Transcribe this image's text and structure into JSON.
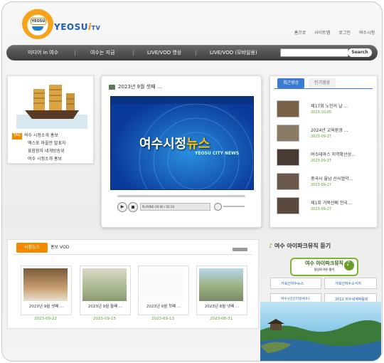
{
  "header": {
    "logo_badge": "YEOSU",
    "brand_name": "YEOSU",
    "brand_i": "i",
    "brand_tv": "TV",
    "top_links": [
      "홈으로",
      "사이트맵",
      "로그인",
      "여수시청"
    ]
  },
  "nav": {
    "items": [
      "미디어 in 여수",
      "여수는 지금",
      "LIVE/VOD 영상",
      "LIVE/VOD (모바일용)"
    ],
    "search_placeholder": "",
    "search_button": "Search"
  },
  "left_menu": {
    "tag": "TAG",
    "items": [
      "여수 시정소개 홍보",
      "엑스포 마을안 발표자",
      "표장장자 네게방송위",
      "여수 시정소개 홍보"
    ]
  },
  "video": {
    "title": "2023년 9월 셋째 ...",
    "screen_title_a": "여수시정",
    "screen_title_b": "뉴스",
    "screen_sub": "YEOSU CITY NEWS",
    "status_text": "PLAYING  00:00 / 02:34"
  },
  "recent": {
    "tab_active": "최근영상",
    "tab_inactive": "인기영상",
    "items": [
      {
        "title": "제17회 노인의 날 ...",
        "date": "2023-10-05"
      },
      {
        "title": "2024년 교육환경 ...",
        "date": "2023-09-27"
      },
      {
        "title": "여수테마스 지역확산상...",
        "date": "2023-09-27"
      },
      {
        "title": "중국사 율남 산사협약...",
        "date": "2023-09-27"
      },
      {
        "title": "제1회 거북선배 전국...",
        "date": "2023-09-27"
      }
    ]
  },
  "city_news": {
    "tab_active": "시정뉴스",
    "tab_inactive": "홍보 VOD",
    "cards": [
      {
        "caption": "2023년 9월 셋째 ...",
        "date": "2023-09-22"
      },
      {
        "caption": "2023년 9월 둘째 ...",
        "date": "2023-09-15"
      },
      {
        "caption": "2023년 9월 첫째 ...",
        "date": "2023-09-13"
      },
      {
        "caption": "2023년 8월 넷째 ...",
        "date": "2023-08-31"
      }
    ]
  },
  "music": {
    "title": "여수 아이파크뮤직 듣기",
    "banner": "여수 아이파크뮤직",
    "banner_sub": "당신의 여수 듣기",
    "buttons": [
      "거북선여수뉴스",
      "거북선여수소식지",
      "여수시민인터넷서비스",
      "2012 여수세계박람회"
    ]
  },
  "colors": {
    "accent_orange": "#f28a00",
    "accent_blue": "#3b7bd0",
    "date_green": "#5aa02c",
    "nav_dark": "#3c3c3c"
  }
}
